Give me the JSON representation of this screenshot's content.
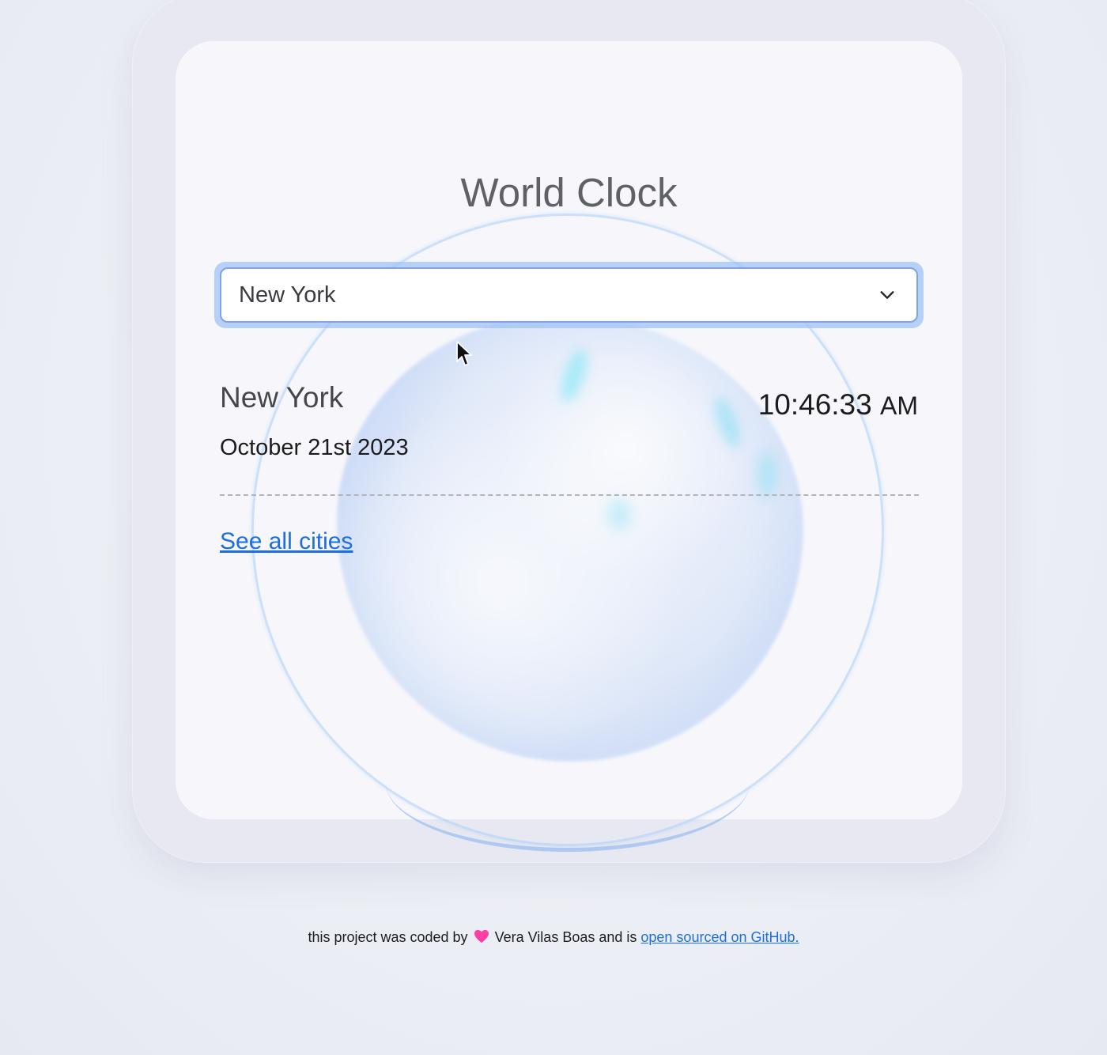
{
  "app": {
    "title": "World Clock"
  },
  "city_select": {
    "selected": "New York"
  },
  "current_city": {
    "name": "New York",
    "date": "October 21st 2023",
    "time": "10:46:33",
    "ampm": "AM"
  },
  "links": {
    "see_all": "See all cities"
  },
  "footer": {
    "prefix": "this project was coded by",
    "author": "Vera Vilas Boas and is",
    "link_text": "open sourced on GitHub."
  },
  "colors": {
    "accent": "#1b6fe0",
    "heart": "#ff3fa4"
  }
}
